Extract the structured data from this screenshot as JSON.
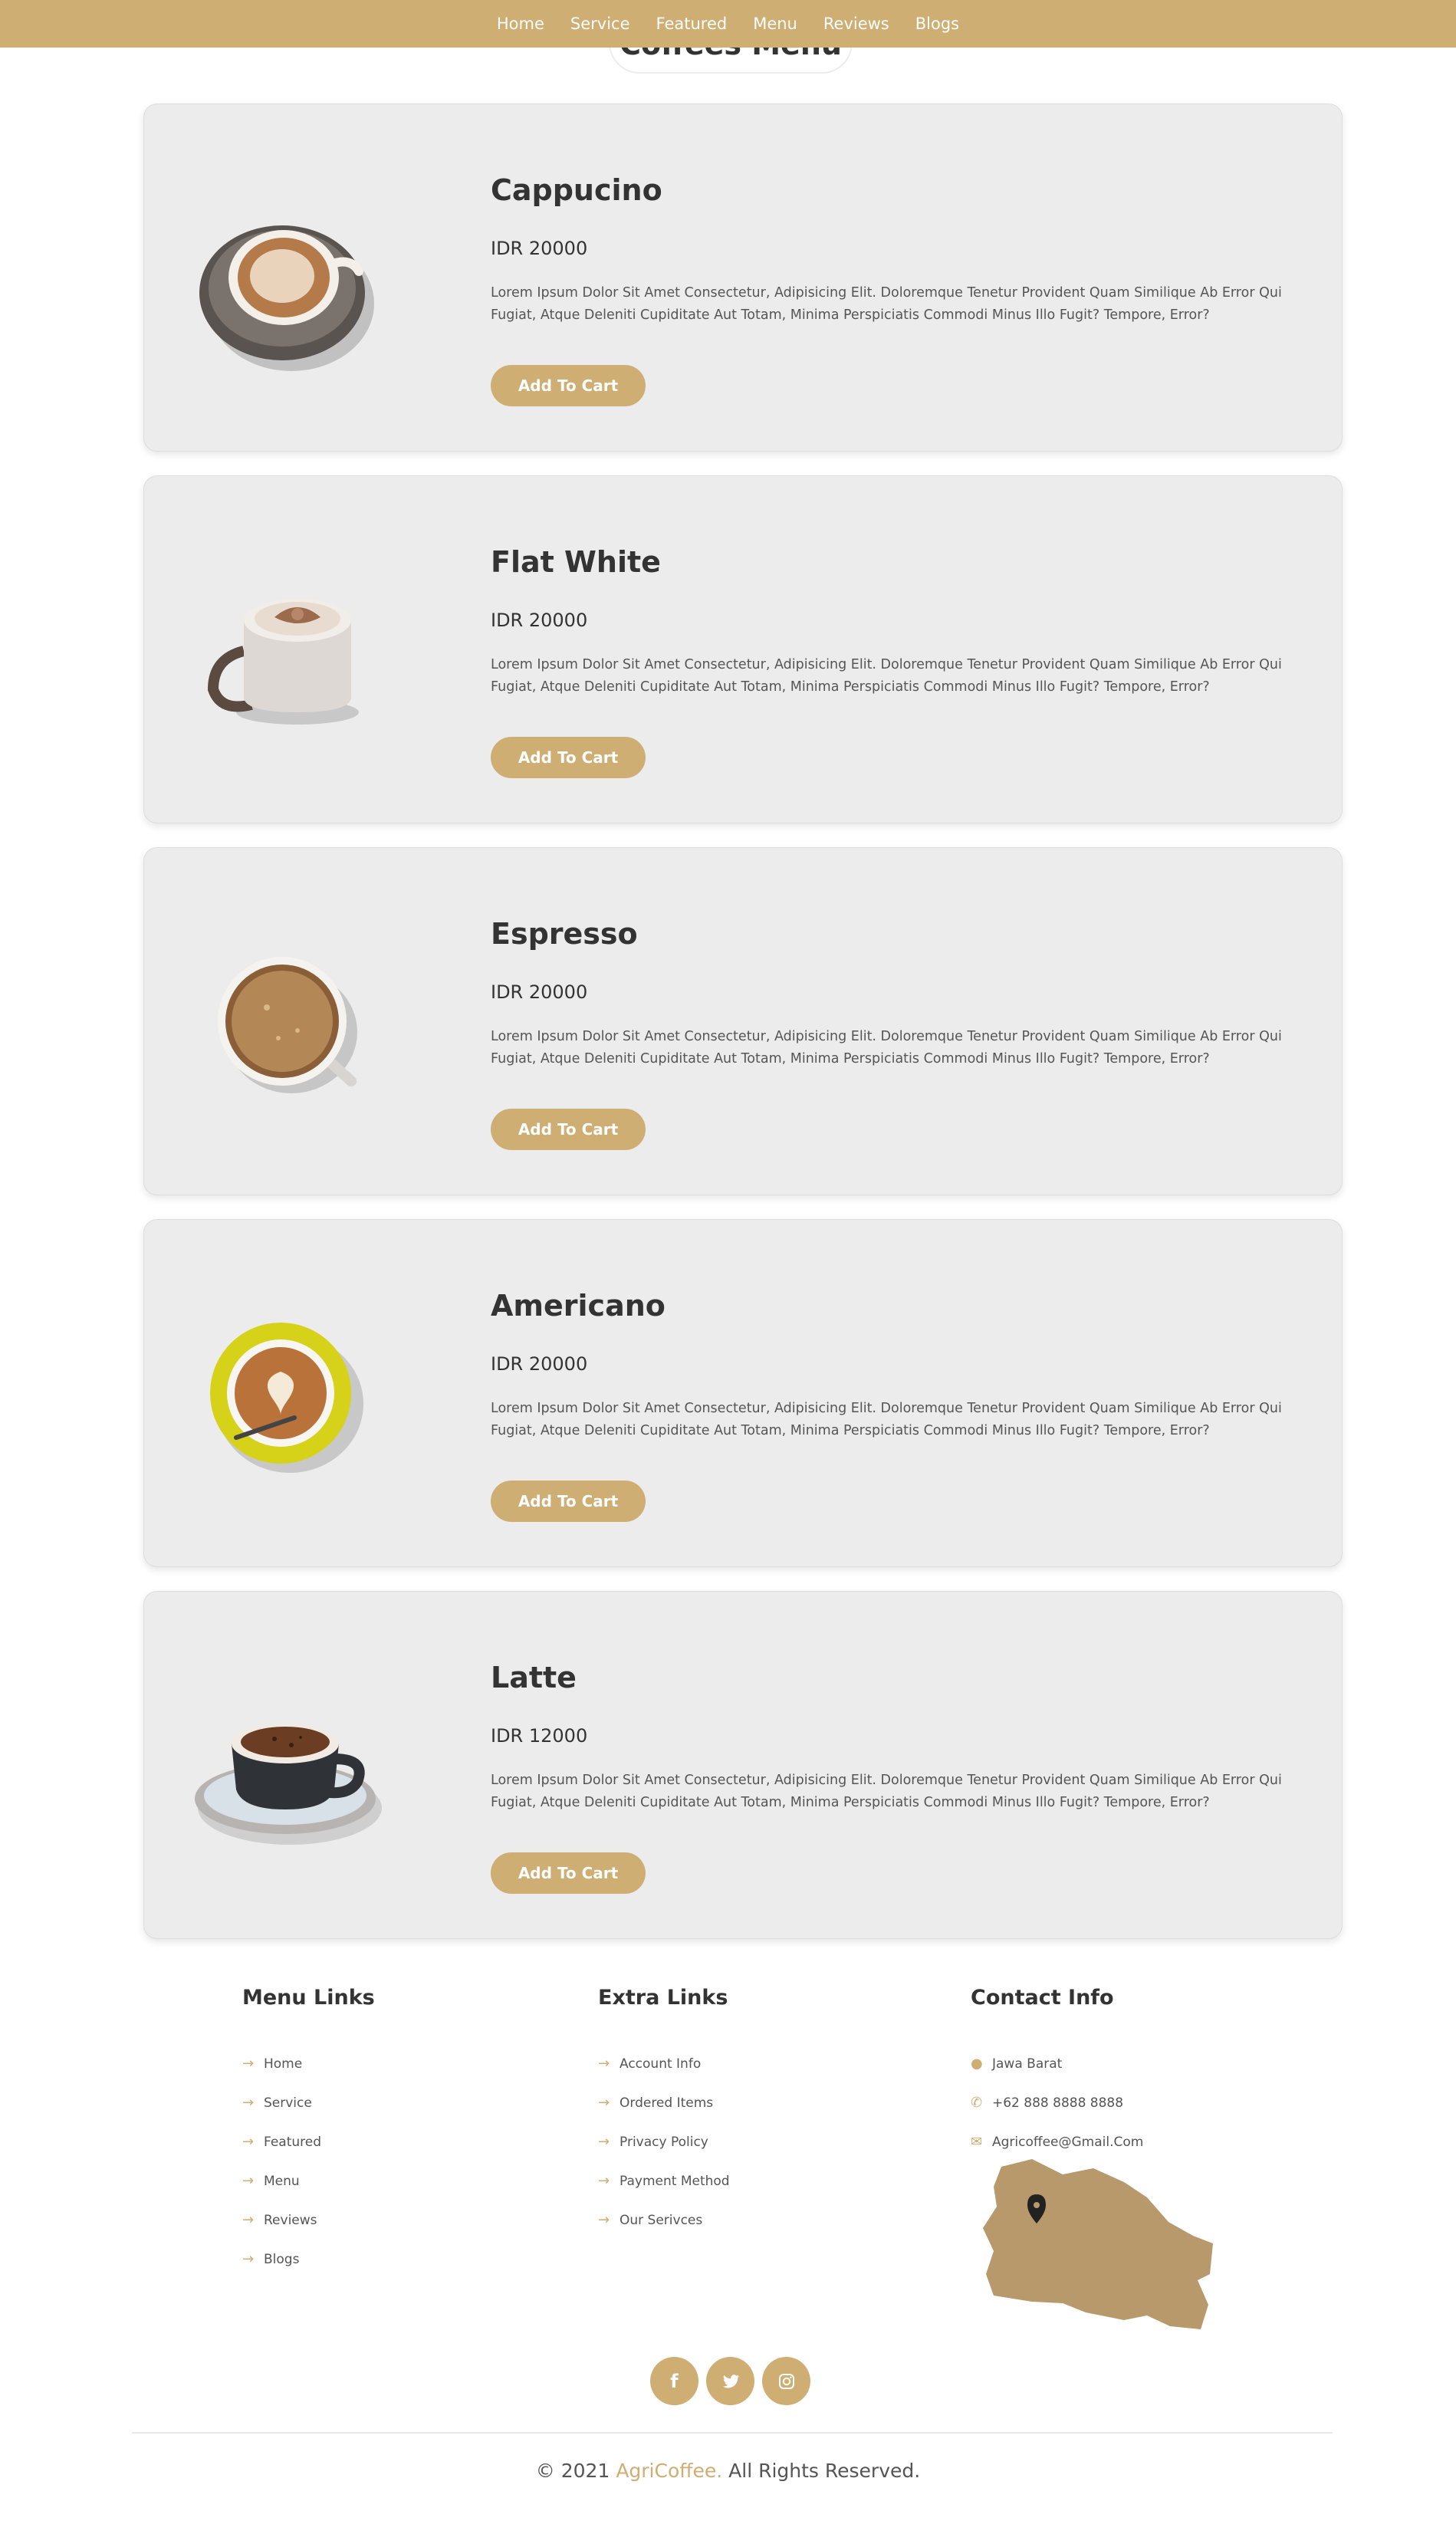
{
  "nav": [
    "Home",
    "Service",
    "Featured",
    "Menu",
    "Reviews",
    "Blogs"
  ],
  "section_title": "Coffees Menu",
  "products": [
    {
      "name": "Cappucino",
      "price": "IDR 20000",
      "description": "Lorem Ipsum Dolor Sit Amet Consectetur, Adipisicing Elit. Doloremque Tenetur Provident Quam Similique Ab Error Qui Fugiat, Atque Deleniti Cupiditate Aut Totam, Minima Perspiciatis Commodi Minus Illo Fugit? Tempore, Error?",
      "button": "Add To Cart"
    },
    {
      "name": "Flat White",
      "price": "IDR 20000",
      "description": "Lorem Ipsum Dolor Sit Amet Consectetur, Adipisicing Elit. Doloremque Tenetur Provident Quam Similique Ab Error Qui Fugiat, Atque Deleniti Cupiditate Aut Totam, Minima Perspiciatis Commodi Minus Illo Fugit? Tempore, Error?",
      "button": "Add To Cart"
    },
    {
      "name": "Espresso",
      "price": "IDR 20000",
      "description": "Lorem Ipsum Dolor Sit Amet Consectetur, Adipisicing Elit. Doloremque Tenetur Provident Quam Similique Ab Error Qui Fugiat, Atque Deleniti Cupiditate Aut Totam, Minima Perspiciatis Commodi Minus Illo Fugit? Tempore, Error?",
      "button": "Add To Cart"
    },
    {
      "name": "Americano",
      "price": "IDR 20000",
      "description": "Lorem Ipsum Dolor Sit Amet Consectetur, Adipisicing Elit. Doloremque Tenetur Provident Quam Similique Ab Error Qui Fugiat, Atque Deleniti Cupiditate Aut Totam, Minima Perspiciatis Commodi Minus Illo Fugit? Tempore, Error?",
      "button": "Add To Cart"
    },
    {
      "name": "Latte",
      "price": "IDR 12000",
      "description": "Lorem Ipsum Dolor Sit Amet Consectetur, Adipisicing Elit. Doloremque Tenetur Provident Quam Similique Ab Error Qui Fugiat, Atque Deleniti Cupiditate Aut Totam, Minima Perspiciatis Commodi Minus Illo Fugit? Tempore, Error?",
      "button": "Add To Cart"
    }
  ],
  "footer": {
    "menu_links": {
      "title": "Menu Links",
      "items": [
        "Home",
        "Service",
        "Featured",
        "Menu",
        "Reviews",
        "Blogs"
      ]
    },
    "extra_links": {
      "title": "Extra Links",
      "items": [
        "Account Info",
        "Ordered Items",
        "Privacy Policy",
        "Payment Method",
        "Our Serivces"
      ]
    },
    "contact": {
      "title": "Contact Info",
      "address": "Jawa Barat",
      "phone": "+62 888 8888 8888",
      "email": "Agricoffee@Gmail.Com"
    },
    "socials": [
      "facebook-icon",
      "twitter-icon",
      "instagram-icon"
    ],
    "copyright_prefix": "© 2021",
    "brand": "AgriCoffee.",
    "copyright_suffix": "All Rights Reserved."
  },
  "colors": {
    "accent": "#cfae74",
    "card_bg": "#ececec",
    "text": "#333333"
  }
}
